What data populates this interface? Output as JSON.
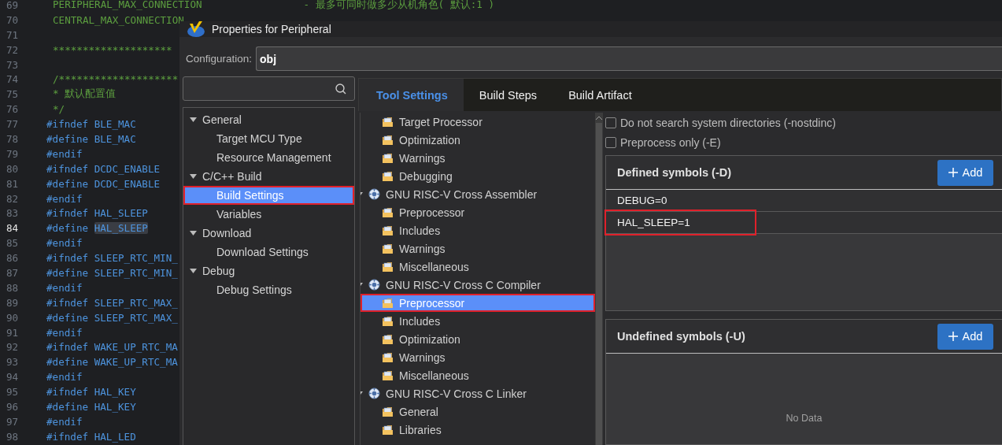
{
  "editor": {
    "lines": [
      {
        "number": "69",
        "current": false,
        "parts": [
          {
            "text": "PERIPHERAL_MAX_CONNECTION",
            "kind": "doc-name",
            "highlighted": false
          },
          {
            "text": "- 最多可同时做多少从机角色( 默认:1 )",
            "kind": "comment",
            "highlighted": false
          }
        ]
      },
      {
        "number": "70",
        "current": false,
        "parts": [
          {
            "text": "CENTRAL_MAX_CONNECTION",
            "kind": "doc-name",
            "highlighted": false
          }
        ]
      },
      {
        "number": "71",
        "current": false
      },
      {
        "number": "72",
        "current": false,
        "parts": [
          {
            "text": "********************",
            "kind": "doc",
            "highlighted": false
          }
        ]
      },
      {
        "number": "73",
        "current": false
      },
      {
        "number": "74",
        "current": false,
        "parts": [
          {
            "text": "/********************",
            "kind": "comment",
            "highlighted": false
          }
        ]
      },
      {
        "number": "75",
        "current": false,
        "parts": [
          {
            "text": "* 默认配置值",
            "kind": "doc",
            "highlighted": false
          }
        ]
      },
      {
        "number": "76",
        "current": false,
        "parts": [
          {
            "text": "*/",
            "kind": "doc",
            "highlighted": false
          }
        ]
      },
      {
        "number": "77",
        "current": false,
        "parts": [
          {
            "text": "#ifndef",
            "kind": "directive",
            "highlighted": false
          },
          {
            "text": "BLE_MAC",
            "kind": "macro",
            "highlighted": false
          }
        ]
      },
      {
        "number": "78",
        "current": false,
        "parts": [
          {
            "text": "#define",
            "kind": "directive",
            "highlighted": false
          },
          {
            "text": "BLE_MAC",
            "kind": "macro",
            "highlighted": false
          }
        ]
      },
      {
        "number": "79",
        "current": false,
        "parts": [
          {
            "text": "#endif",
            "kind": "directive",
            "highlighted": false
          }
        ]
      },
      {
        "number": "80",
        "current": false,
        "parts": [
          {
            "text": "#ifndef",
            "kind": "directive",
            "highlighted": false
          },
          {
            "text": "DCDC_ENABLE",
            "kind": "macro",
            "highlighted": false
          }
        ]
      },
      {
        "number": "81",
        "current": false,
        "parts": [
          {
            "text": "#define",
            "kind": "directive",
            "highlighted": false
          },
          {
            "text": "DCDC_ENABLE",
            "kind": "macro",
            "highlighted": false
          }
        ]
      },
      {
        "number": "82",
        "current": false,
        "parts": [
          {
            "text": "#endif",
            "kind": "directive",
            "highlighted": false
          }
        ]
      },
      {
        "number": "83",
        "current": false,
        "parts": [
          {
            "text": "#ifndef",
            "kind": "directive",
            "highlighted": false
          },
          {
            "text": "HAL_SLEEP",
            "kind": "macro",
            "highlighted": false
          }
        ]
      },
      {
        "number": "84",
        "current": true,
        "parts": [
          {
            "text": "#define",
            "kind": "directive",
            "highlighted": false
          },
          {
            "text": "HAL_SLEEP",
            "kind": "macro",
            "highlighted": true
          }
        ]
      },
      {
        "number": "85",
        "current": false,
        "parts": [
          {
            "text": "#endif",
            "kind": "directive",
            "highlighted": false
          }
        ]
      },
      {
        "number": "86",
        "current": false,
        "parts": [
          {
            "text": "#ifndef",
            "kind": "directive",
            "highlighted": false
          },
          {
            "text": "SLEEP_RTC_MIN_",
            "kind": "macro",
            "highlighted": false
          }
        ]
      },
      {
        "number": "87",
        "current": false,
        "parts": [
          {
            "text": "#define",
            "kind": "directive",
            "highlighted": false
          },
          {
            "text": "SLEEP_RTC_MIN_",
            "kind": "macro",
            "highlighted": false
          }
        ]
      },
      {
        "number": "88",
        "current": false,
        "parts": [
          {
            "text": "#endif",
            "kind": "directive",
            "highlighted": false
          }
        ]
      },
      {
        "number": "89",
        "current": false,
        "parts": [
          {
            "text": "#ifndef",
            "kind": "directive",
            "highlighted": false
          },
          {
            "text": "SLEEP_RTC_MAX_",
            "kind": "macro",
            "highlighted": false
          }
        ]
      },
      {
        "number": "90",
        "current": false,
        "parts": [
          {
            "text": "#define",
            "kind": "directive",
            "highlighted": false
          },
          {
            "text": "SLEEP_RTC_MAX_",
            "kind": "macro",
            "highlighted": false
          }
        ]
      },
      {
        "number": "91",
        "current": false,
        "parts": [
          {
            "text": "#endif",
            "kind": "directive",
            "highlighted": false
          }
        ]
      },
      {
        "number": "92",
        "current": false,
        "parts": [
          {
            "text": "#ifndef",
            "kind": "directive",
            "highlighted": false
          },
          {
            "text": "WAKE_UP_RTC_MA",
            "kind": "macro",
            "highlighted": false
          }
        ]
      },
      {
        "number": "93",
        "current": false,
        "parts": [
          {
            "text": "#define",
            "kind": "directive",
            "highlighted": false
          },
          {
            "text": "WAKE_UP_RTC_MA",
            "kind": "macro",
            "highlighted": false
          }
        ]
      },
      {
        "number": "94",
        "current": false,
        "parts": [
          {
            "text": "#endif",
            "kind": "directive",
            "highlighted": false
          }
        ]
      },
      {
        "number": "95",
        "current": false,
        "parts": [
          {
            "text": "#ifndef",
            "kind": "directive",
            "highlighted": false
          },
          {
            "text": "HAL_KEY",
            "kind": "macro",
            "highlighted": false
          }
        ]
      },
      {
        "number": "96",
        "current": false,
        "parts": [
          {
            "text": "#define",
            "kind": "directive",
            "highlighted": false
          },
          {
            "text": "HAL_KEY",
            "kind": "macro",
            "highlighted": false
          }
        ]
      },
      {
        "number": "97",
        "current": false,
        "parts": [
          {
            "text": "#endif",
            "kind": "directive",
            "highlighted": false
          }
        ]
      },
      {
        "number": "98",
        "current": false,
        "parts": [
          {
            "text": "#ifndef",
            "kind": "directive",
            "highlighted": false
          },
          {
            "text": "HAL_LED",
            "kind": "macro",
            "highlighted": false
          }
        ]
      }
    ]
  },
  "dialog": {
    "title": "Properties for Peripheral",
    "configuration": {
      "label": "Configuration:",
      "value": "obj"
    },
    "category_tree": [
      {
        "label": "General",
        "expanded": true,
        "selected": false,
        "annotated": false,
        "children": [
          {
            "label": "Target MCU Type",
            "selected": false,
            "annotated": false
          },
          {
            "label": "Resource Management",
            "selected": false,
            "annotated": false
          }
        ]
      },
      {
        "label": "C/C++ Build",
        "expanded": true,
        "selected": false,
        "annotated": false,
        "children": [
          {
            "label": "Build Settings",
            "selected": true,
            "annotated": true
          },
          {
            "label": "Variables",
            "selected": false,
            "annotated": false
          }
        ]
      },
      {
        "label": "Download",
        "expanded": true,
        "selected": false,
        "annotated": false,
        "children": [
          {
            "label": "Download Settings",
            "selected": false,
            "annotated": false
          }
        ]
      },
      {
        "label": "Debug",
        "expanded": true,
        "selected": false,
        "annotated": false,
        "children": [
          {
            "label": "Debug Settings",
            "selected": false,
            "annotated": false
          }
        ]
      }
    ],
    "tabs": [
      {
        "label": "Tool Settings",
        "selected": true
      },
      {
        "label": "Build Steps",
        "selected": false
      },
      {
        "label": "Build Artifact",
        "selected": false
      }
    ],
    "tool_tree": [
      {
        "label": "Target Processor",
        "kind": "page",
        "selected": false,
        "annotated": false
      },
      {
        "label": "Optimization",
        "kind": "page",
        "selected": false,
        "annotated": false
      },
      {
        "label": "Warnings",
        "kind": "page",
        "selected": false,
        "annotated": false
      },
      {
        "label": "Debugging",
        "kind": "page",
        "selected": false,
        "annotated": false
      },
      {
        "label": "GNU RISC-V Cross Assembler",
        "kind": "tool",
        "expanded": true,
        "selected": false,
        "annotated": false,
        "children": [
          {
            "label": "Preprocessor",
            "kind": "page",
            "selected": false,
            "annotated": false
          },
          {
            "label": "Includes",
            "kind": "page",
            "selected": false,
            "annotated": false
          },
          {
            "label": "Warnings",
            "kind": "page",
            "selected": false,
            "annotated": false
          },
          {
            "label": "Miscellaneous",
            "kind": "page",
            "selected": false,
            "annotated": false
          }
        ]
      },
      {
        "label": "GNU RISC-V Cross C Compiler",
        "kind": "tool",
        "expanded": true,
        "selected": false,
        "annotated": false,
        "children": [
          {
            "label": "Preprocessor",
            "kind": "page",
            "selected": true,
            "annotated": true
          },
          {
            "label": "Includes",
            "kind": "page",
            "selected": false,
            "annotated": false
          },
          {
            "label": "Optimization",
            "kind": "page",
            "selected": false,
            "annotated": false
          },
          {
            "label": "Warnings",
            "kind": "page",
            "selected": false,
            "annotated": false
          },
          {
            "label": "Miscellaneous",
            "kind": "page",
            "selected": false,
            "annotated": false
          }
        ]
      },
      {
        "label": "GNU RISC-V Cross C Linker",
        "kind": "tool",
        "expanded": true,
        "selected": false,
        "annotated": false,
        "children": [
          {
            "label": "General",
            "kind": "page",
            "selected": false,
            "annotated": false
          },
          {
            "label": "Libraries",
            "kind": "page",
            "selected": false,
            "annotated": false
          }
        ]
      }
    ],
    "options": [
      {
        "label": "Do not search system directories (-nostdinc)",
        "checked": false
      },
      {
        "label": "Preprocess only (-E)",
        "checked": false
      }
    ],
    "symbol_lists": [
      {
        "title": "Defined symbols (-D)",
        "add_label": "Add",
        "items": [
          {
            "text": "DEBUG=0",
            "annotated": false
          },
          {
            "text": "HAL_SLEEP=1",
            "annotated": true
          }
        ]
      },
      {
        "title": "Undefined symbols (-U)",
        "add_label": "Add",
        "empty_text": "No Data"
      }
    ]
  }
}
